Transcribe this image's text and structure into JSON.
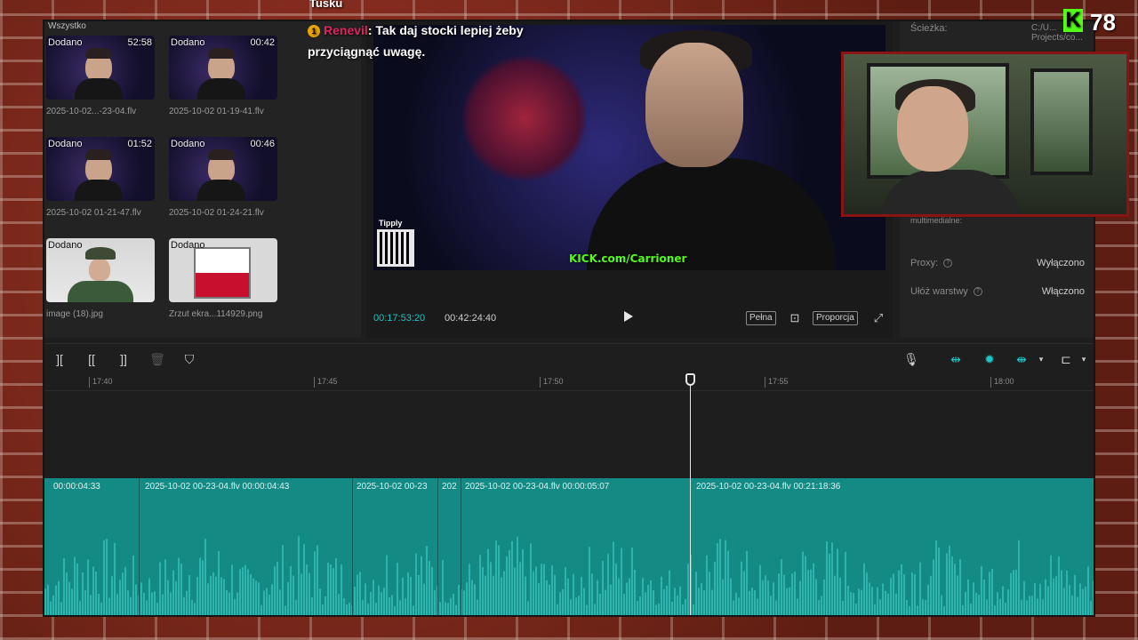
{
  "overlay": {
    "chat_user_line": "Tusku",
    "chat_badge": "1",
    "chat_name": "Renevil",
    "chat_text": ": Tak daj stocki lepiej żeby przyciągnąć uwagę.",
    "viewer_count": "78",
    "kick_logo_letter": "K",
    "watermark": "KICK.com/Carrioner",
    "qr_label": "Tipply"
  },
  "media_panel": {
    "title": "Wszystko",
    "items": [
      {
        "badge": "Dodano",
        "duration": "52:58",
        "name": "2025-10-02...-23-04.flv",
        "kind": "video"
      },
      {
        "badge": "Dodano",
        "duration": "00:42",
        "name": "2025-10-02 01-19-41.flv",
        "kind": "video"
      },
      {
        "badge": "Dodano",
        "duration": "01:52",
        "name": "2025-10-02 01-21-47.flv",
        "kind": "video"
      },
      {
        "badge": "Dodano",
        "duration": "00:46",
        "name": "2025-10-02 01-24-21.flv",
        "kind": "video"
      },
      {
        "badge": "Dodano",
        "duration": "",
        "name": "image (18).jpg",
        "kind": "officer"
      },
      {
        "badge": "Dodano",
        "duration": "",
        "name": "Zrzut ekra...114929.png",
        "kind": "screenshot"
      }
    ]
  },
  "player": {
    "current_time": "00:17:53:20",
    "total_time": "00:42:24:40",
    "btn_full": "Pełna",
    "btn_ratio": "Proporcja"
  },
  "properties": {
    "path_label": "Ścieżka:",
    "path_value": "C:/U... Projects/co...",
    "multimedia_label": "multimedialne:",
    "proxy_label": "Proxy:",
    "proxy_value": "Wyłączono",
    "layers_label": "Ułóż warstwy",
    "layers_value": "Włączono"
  },
  "timeline": {
    "ruler": [
      "17:40",
      "17:45",
      "17:50",
      "17:55",
      "18:00"
    ],
    "clips": [
      {
        "label": "00:00:04:33"
      },
      {
        "label": "2025-10-02 00-23-04.flv   00:00:04:43"
      },
      {
        "label": "2025-10-02 00-23"
      },
      {
        "label": "202"
      },
      {
        "label": "2025-10-02 00-23-04.flv   00:00:05:07"
      },
      {
        "label": "2025-10-02 00-23-04.flv   00:21:18:36"
      }
    ]
  },
  "icons": {
    "split": "split-icon",
    "trim_left": "trim-left-icon",
    "trim_right": "trim-right-icon",
    "delete": "delete-icon",
    "marker": "marker-icon",
    "mic": "mic-icon",
    "link": "link-icon",
    "magnet": "magnet-icon",
    "preview": "preview-axis-icon",
    "zoom": "zoom-fit-icon"
  },
  "colors": {
    "accent": "#20c4c4",
    "track": "#148a85",
    "kick": "#53fc18",
    "chat_name": "#e0245e"
  }
}
